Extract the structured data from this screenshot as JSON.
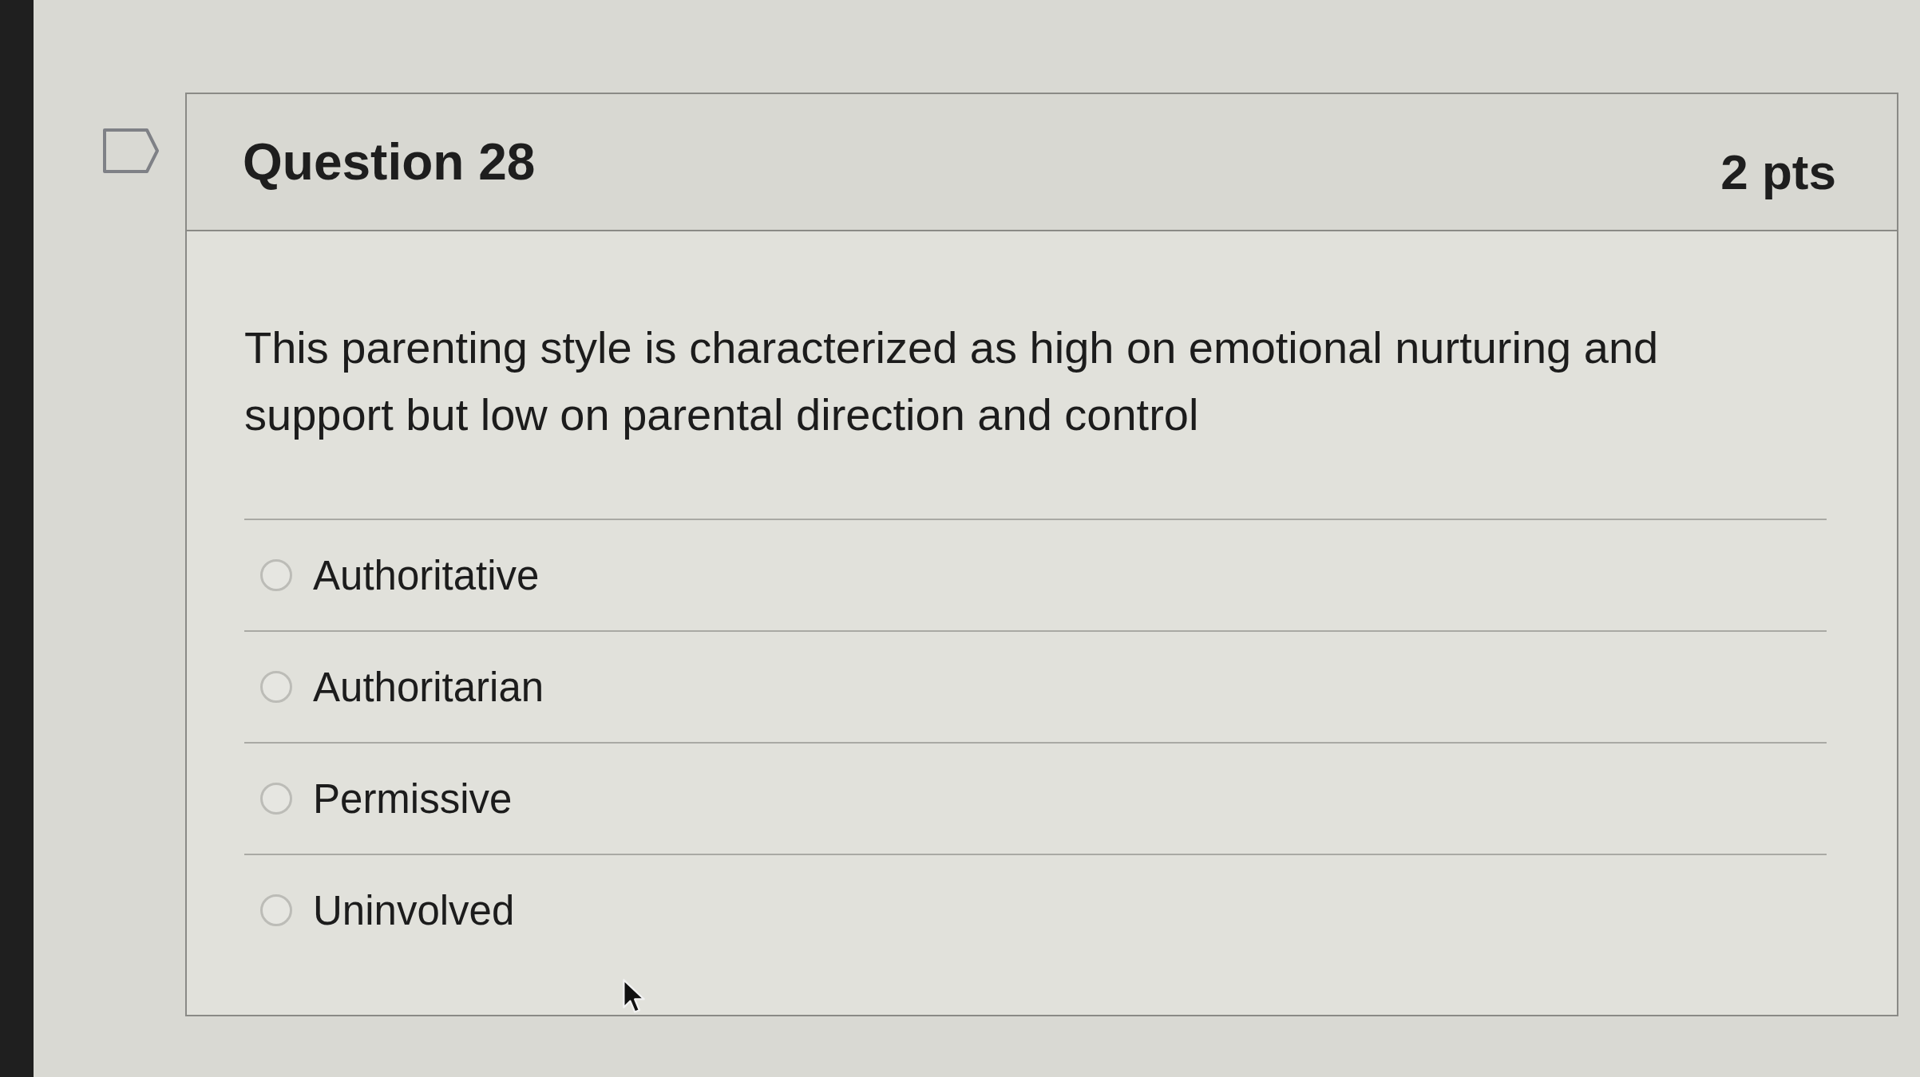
{
  "question": {
    "title": "Question 28",
    "points": "2 pts",
    "text": "This parenting style is characterized as high on emotional nurturing and support but low on parental direction and control"
  },
  "answers": [
    {
      "label": "Authoritative",
      "selected": false
    },
    {
      "label": "Authoritarian",
      "selected": false
    },
    {
      "label": "Permissive",
      "selected": false
    },
    {
      "label": "Uninvolved",
      "selected": false
    }
  ]
}
